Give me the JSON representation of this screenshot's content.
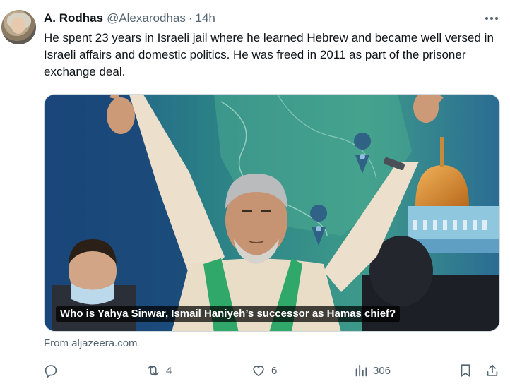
{
  "tweet": {
    "author_name": "A. Rodhas",
    "handle": "@Alexarodhas",
    "separator": "·",
    "time": "14h",
    "text": "He spent 23 years in Israeli jail where he learned Hebrew and became well versed in Israeli affairs and domestic politics. He was freed in 2011 as part of the prisoner exchange deal."
  },
  "card": {
    "title": "Who is Yahya Sinwar, Ismail Haniyeh’s successor as Hamas chief?",
    "source": "From aljazeera.com"
  },
  "actions": {
    "reply": {
      "icon": "reply-icon",
      "count": ""
    },
    "retweet": {
      "icon": "retweet-icon",
      "count": "4"
    },
    "like": {
      "icon": "heart-icon",
      "count": "6"
    },
    "views": {
      "icon": "views-chart-icon",
      "count": "306"
    },
    "bookmark": {
      "icon": "bookmark-icon"
    },
    "share": {
      "icon": "share-icon"
    }
  },
  "colors": {
    "text": "#0f1419",
    "secondary": "#536471",
    "border": "#cfd9de"
  }
}
